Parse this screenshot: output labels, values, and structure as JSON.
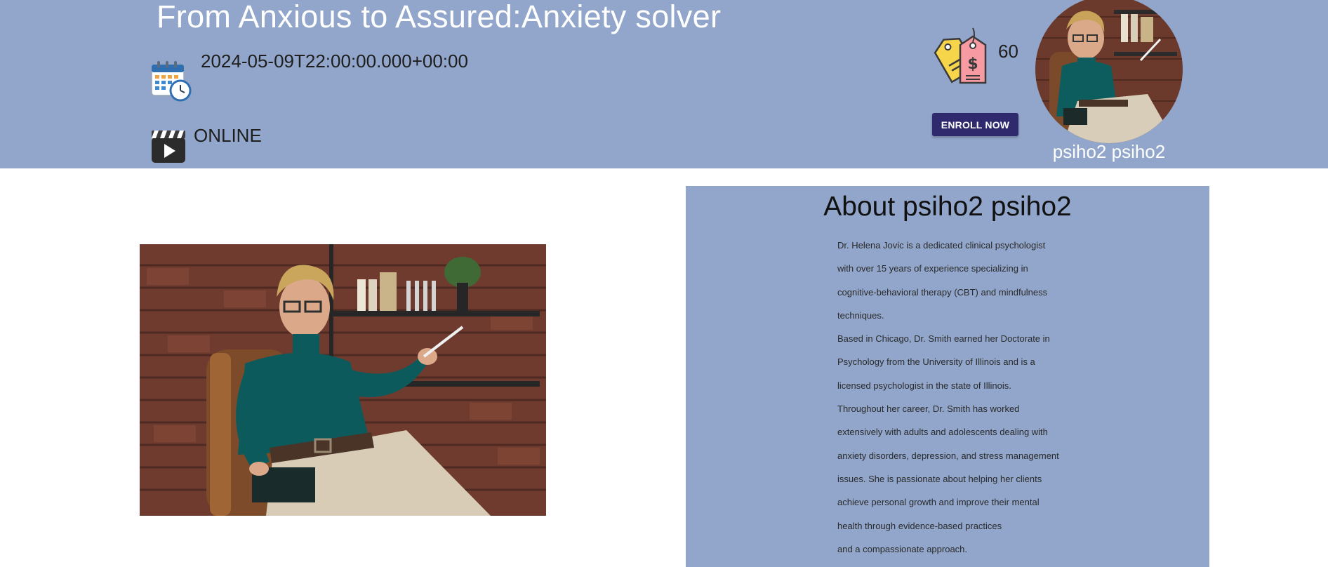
{
  "course": {
    "title": "From Anxious to Assured:Anxiety solver",
    "date": "2024-05-09T22:00:00.000+00:00",
    "format": "ONLINE",
    "price": "60",
    "enroll_label": "ENROLL NOW"
  },
  "instructor": {
    "name": "psiho2 psiho2"
  },
  "about": {
    "title": "About psiho2 psiho2",
    "lines": [
      "Dr. Helena Jovic is a dedicated clinical psychologist",
      "with over 15 years of experience specializing in",
      "cognitive-behavioral therapy (CBT) and mindfulness",
      "techniques.",
      "Based in Chicago, Dr. Smith earned her Doctorate in",
      "Psychology from the University of Illinois and is a",
      "licensed psychologist in the state of Illinois.",
      "Throughout her career, Dr. Smith has worked",
      "extensively with adults and adolescents dealing with",
      "anxiety disorders, depression, and stress management",
      "issues. She is passionate about helping her clients",
      "achieve personal growth and improve their mental",
      "health through evidence-based practices",
      "and a compassionate approach."
    ]
  },
  "icons": {
    "date": "calendar-clock-icon",
    "format": "video-clapperboard-icon",
    "price": "price-tag-icon"
  },
  "colors": {
    "header_bg": "#91a6ca",
    "panel_bg": "#91a6ca",
    "button_bg": "#2f2a6e",
    "title_text": "#ffffff"
  }
}
